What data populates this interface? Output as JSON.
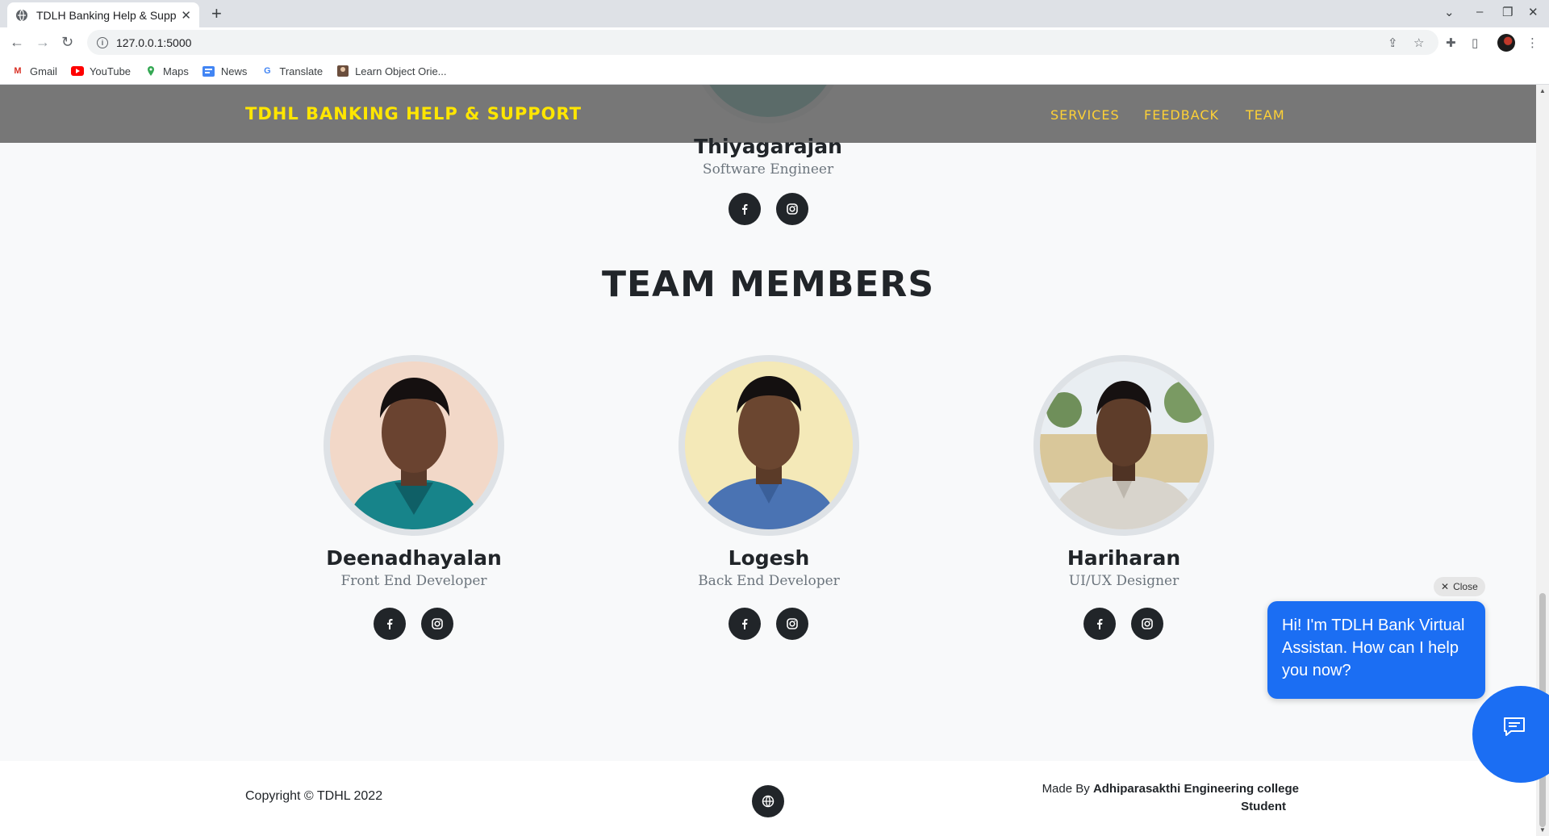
{
  "browser": {
    "tab_title": "TDLH Banking Help & Suppor",
    "url": "127.0.0.1:5000",
    "bookmarks": [
      {
        "label": "Gmail",
        "icon": "gmail-icon"
      },
      {
        "label": "YouTube",
        "icon": "youtube-icon"
      },
      {
        "label": "Maps",
        "icon": "maps-icon"
      },
      {
        "label": "News",
        "icon": "news-icon"
      },
      {
        "label": "Translate",
        "icon": "translate-icon"
      },
      {
        "label": "Learn Object Orie...",
        "icon": "bookmark-favicon-icon"
      }
    ]
  },
  "navbar": {
    "brand": "TDHL BANKING HELP & SUPPORT",
    "links": [
      "SERVICES",
      "FEEDBACK",
      "TEAM"
    ]
  },
  "lead": {
    "name": "Thiyagarajan",
    "role": "Software Engineer"
  },
  "team": {
    "title": "TEAM MEMBERS",
    "members": [
      {
        "name": "Deenadhayalan",
        "role": "Front End Developer"
      },
      {
        "name": "Logesh",
        "role": "Back End Developer"
      },
      {
        "name": "Hariharan",
        "role": "UI/UX Designer"
      }
    ]
  },
  "footer": {
    "copyright": "Copyright © TDHL 2022",
    "made_by_prefix": "Made By",
    "made_by_org": "Adhiparasakthi Engineering college",
    "made_by_suffix": "Student"
  },
  "chat": {
    "close_label": "Close",
    "message": "Hi! I'm TDLH Bank Virtual Assistan. How can I help you now?"
  },
  "colors": {
    "brand_yellow": "#ffe600",
    "nav_link": "#fed136",
    "chat_blue": "#1b6ef3",
    "dark": "#212529"
  }
}
